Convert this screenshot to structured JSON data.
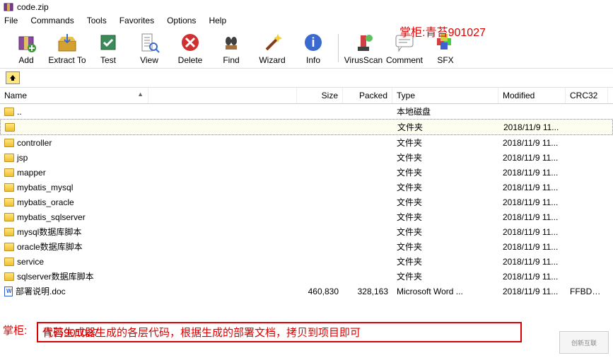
{
  "window": {
    "title": "code.zip",
    "icon": "archive-icon"
  },
  "menu": {
    "items": [
      "File",
      "Commands",
      "Tools",
      "Favorites",
      "Options",
      "Help"
    ]
  },
  "watermark_top": "掌柜:青苔901027",
  "toolbar": {
    "groups": [
      [
        {
          "name": "add",
          "label": "Add",
          "icon": "archive-add"
        },
        {
          "name": "extract",
          "label": "Extract To",
          "icon": "archive-extract"
        },
        {
          "name": "test",
          "label": "Test",
          "icon": "test"
        },
        {
          "name": "view",
          "label": "View",
          "icon": "view"
        },
        {
          "name": "delete",
          "label": "Delete",
          "icon": "delete"
        },
        {
          "name": "find",
          "label": "Find",
          "icon": "find"
        },
        {
          "name": "wizard",
          "label": "Wizard",
          "icon": "wizard"
        },
        {
          "name": "info",
          "label": "Info",
          "icon": "info"
        }
      ],
      [
        {
          "name": "virusscan",
          "label": "VirusScan",
          "icon": "virus"
        },
        {
          "name": "comment",
          "label": "Comment",
          "icon": "comment"
        },
        {
          "name": "sfx",
          "label": "SFX",
          "icon": "sfx"
        }
      ]
    ]
  },
  "nav": {
    "up_icon": "up-icon"
  },
  "columns": {
    "name": "Name",
    "spacer": "",
    "size": "Size",
    "packed": "Packed",
    "type": "Type",
    "modified": "Modified",
    "crc": "CRC32",
    "sort_col": "name",
    "sort_dir": "asc"
  },
  "rows": [
    {
      "icon": "folder",
      "name": "..",
      "size": "",
      "packed": "",
      "type": "本地磁盘",
      "modified": "",
      "crc": "",
      "sel": false
    },
    {
      "icon": "folder",
      "name": "",
      "size": "",
      "packed": "",
      "type": "文件夹",
      "modified": "2018/11/9 11...",
      "crc": "",
      "sel": true
    },
    {
      "icon": "folder",
      "name": "controller",
      "size": "",
      "packed": "",
      "type": "文件夹",
      "modified": "2018/11/9 11...",
      "crc": "",
      "sel": false
    },
    {
      "icon": "folder",
      "name": "jsp",
      "size": "",
      "packed": "",
      "type": "文件夹",
      "modified": "2018/11/9 11...",
      "crc": "",
      "sel": false
    },
    {
      "icon": "folder",
      "name": "mapper",
      "size": "",
      "packed": "",
      "type": "文件夹",
      "modified": "2018/11/9 11...",
      "crc": "",
      "sel": false
    },
    {
      "icon": "folder",
      "name": "mybatis_mysql",
      "size": "",
      "packed": "",
      "type": "文件夹",
      "modified": "2018/11/9 11...",
      "crc": "",
      "sel": false
    },
    {
      "icon": "folder",
      "name": "mybatis_oracle",
      "size": "",
      "packed": "",
      "type": "文件夹",
      "modified": "2018/11/9 11...",
      "crc": "",
      "sel": false
    },
    {
      "icon": "folder",
      "name": "mybatis_sqlserver",
      "size": "",
      "packed": "",
      "type": "文件夹",
      "modified": "2018/11/9 11...",
      "crc": "",
      "sel": false
    },
    {
      "icon": "folder",
      "name": "mysql数据库脚本",
      "size": "",
      "packed": "",
      "type": "文件夹",
      "modified": "2018/11/9 11...",
      "crc": "",
      "sel": false
    },
    {
      "icon": "folder",
      "name": "oracle数据库脚本",
      "size": "",
      "packed": "",
      "type": "文件夹",
      "modified": "2018/11/9 11...",
      "crc": "",
      "sel": false
    },
    {
      "icon": "folder",
      "name": "service",
      "size": "",
      "packed": "",
      "type": "文件夹",
      "modified": "2018/11/9 11...",
      "crc": "",
      "sel": false
    },
    {
      "icon": "folder",
      "name": "sqlserver数据库脚本",
      "size": "",
      "packed": "",
      "type": "文件夹",
      "modified": "2018/11/9 11...",
      "crc": "",
      "sel": false
    },
    {
      "icon": "doc",
      "name": "部署说明.doc",
      "size": "460,830",
      "packed": "328,163",
      "type": "Microsoft Word ...",
      "modified": "2018/11/9 11...",
      "crc": "FFBDBC...",
      "sel": false
    }
  ],
  "bottom": {
    "label": "掌柜:",
    "overlay": "青苔901027",
    "text": "代码生成器生成的各层代码，根据生成的部署文档，拷贝到项目即可"
  },
  "corner_logo": "创新互联"
}
